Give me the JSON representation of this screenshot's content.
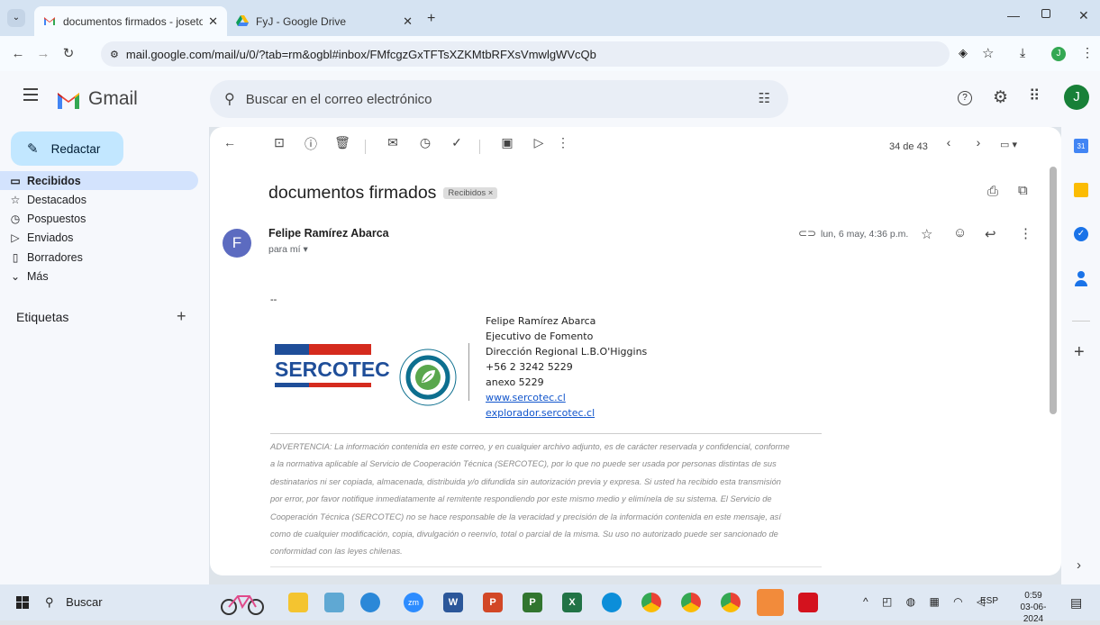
{
  "browser": {
    "tabs": [
      {
        "label": "documentos firmados - josetor",
        "icon": "gmail-icon",
        "active": true
      },
      {
        "label": "FyJ - Google Drive",
        "icon": "google-drive-icon",
        "active": false
      }
    ],
    "url": "mail.google.com/mail/u/0/?tab=rm&ogbl#inbox/FMfcgzGxTFTsXZKMtbRFXsVmwlgWVcQb",
    "profile_initial": "J"
  },
  "gmail": {
    "brand": "Gmail",
    "search_placeholder": "Buscar en el correo electrónico",
    "account_initial": "J"
  },
  "sidebar": {
    "compose_label": "Redactar",
    "items": [
      {
        "label": "Recibidos",
        "icon": "inbox-icon"
      },
      {
        "label": "Destacados",
        "icon": "star-icon"
      },
      {
        "label": "Pospuestos",
        "icon": "clock-icon"
      },
      {
        "label": "Enviados",
        "icon": "send-icon"
      },
      {
        "label": "Borradores",
        "icon": "draft-icon"
      },
      {
        "label": "Más",
        "icon": "chevron-down-icon"
      }
    ],
    "labels_heading": "Etiquetas"
  },
  "message": {
    "pagination": "34 de 43",
    "subject": "documentos firmados",
    "label_chip": "Recibidos",
    "sender_initial": "F",
    "sender": "Felipe Ramírez Abarca",
    "recipient": "para mí",
    "date": "lun, 6 may, 4:36 p.m.",
    "separator": "--",
    "signature": {
      "name": "Felipe Ramírez Abarca",
      "role": "Ejecutivo de Fomento",
      "office": "Dirección Regional L.B.O'Higgins",
      "phone": "+56 2 3242 5229",
      "extension": "anexo 5229",
      "link1": "www.sercotec.cl",
      "link2": "explorador.sercotec.cl",
      "logo_text": "SERCOTEC"
    },
    "disclaimer": [
      "ADVERTENCIA: La información contenida en este correo, y en cualquier archivo adjunto, es de carácter reservada y confidencial, conforme",
      "a la normativa aplicable al Servicio de Cooperación Técnica (SERCOTEC), por lo que no puede ser usada por personas distintas de sus",
      "destinatarios ni ser copiada, almacenada, distribuida y/o difundida sin autorización previa y expresa. Si usted ha recibido esta transmisión",
      "por error, por favor notifique inmediatamente al remitente respondiendo por este mismo medio y elimínela de su sistema. El Servicio de",
      "Cooperación Técnica (SERCOTEC) no se hace responsable de la veracidad y precisión de la información contenida en este mensaje, así",
      "como de cualquier modificación, copia, divulgación o reenvío, total o parcial de la misma. Su uso no autorizado puede ser sancionado de",
      "conformidad con las leyes chilenas."
    ]
  },
  "taskbar": {
    "search_label": "Buscar",
    "language": "ESP",
    "time": "0:59",
    "date": "03-06-2024"
  },
  "colors": {
    "gmail_red": "#ea4335",
    "compose_bg": "#c2e7ff",
    "selected_bg": "#d3e3fd",
    "sercotec_blue": "#1f4e99",
    "sercotec_red": "#d52b1e"
  }
}
